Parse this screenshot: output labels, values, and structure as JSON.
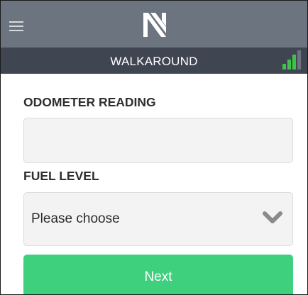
{
  "header": {
    "logo_icon": "n-logo-icon",
    "menu_icon": "hamburger-menu-icon",
    "title": "WALKAROUND",
    "signal_icon": "signal-bars-icon",
    "colors": {
      "topbar": "#6c7480",
      "subbar": "#3f4651",
      "signal": "#3fc24a"
    }
  },
  "form": {
    "odometer": {
      "label": "ODOMETER READING",
      "value": "",
      "placeholder": ""
    },
    "fuel": {
      "label": "FUEL LEVEL",
      "selected": "Please choose",
      "dropdown_icon": "chevron-down-icon"
    },
    "next_label": "Next",
    "colors": {
      "next_button": "#3fd07e",
      "field_bg": "#f3f3f3"
    }
  }
}
